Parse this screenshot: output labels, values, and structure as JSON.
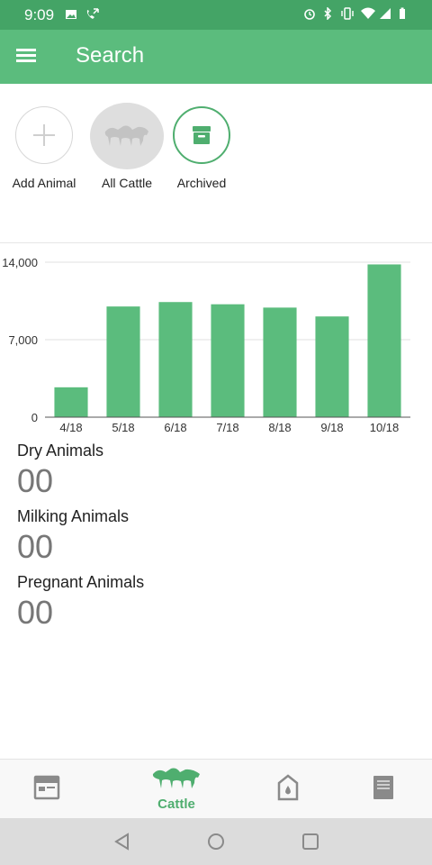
{
  "status_bar": {
    "time": "9:09",
    "left_icons": [
      "image-icon",
      "call-forward-icon"
    ],
    "right_icons": [
      "alarm-icon",
      "bluetooth-icon",
      "vibrate-icon",
      "wifi-icon",
      "signal-icon",
      "battery-icon"
    ]
  },
  "app_bar": {
    "title": "Search",
    "menu_icon": "menu-icon",
    "color": "#5bbc7d"
  },
  "quick_actions": [
    {
      "label": "Add Animal",
      "icon": "plus-icon"
    },
    {
      "label": "All Cattle",
      "icon": "cattle-icon"
    },
    {
      "label": "Archived",
      "icon": "archive-box-icon"
    }
  ],
  "chart_data": {
    "type": "bar",
    "categories": [
      "4/18",
      "5/18",
      "6/18",
      "7/18",
      "8/18",
      "9/18",
      "10/18"
    ],
    "values": [
      2700,
      10000,
      10400,
      10200,
      9900,
      9100,
      13800
    ],
    "ylim": [
      0,
      14000
    ],
    "yticks": [
      "0",
      "7,000",
      "14,000"
    ],
    "ytick_values": [
      0,
      7000,
      14000
    ],
    "grid": true,
    "bar_color": "#5bbc7d"
  },
  "stats": [
    {
      "label": "Dry Animals",
      "value": "00"
    },
    {
      "label": "Milking Animals",
      "value": "00"
    },
    {
      "label": "Pregnant Animals",
      "value": "00"
    }
  ],
  "bottom_nav": [
    {
      "label": "",
      "icon": "calendar-icon"
    },
    {
      "label": "Cattle",
      "icon": "cattle-icon",
      "active": true
    },
    {
      "label": "",
      "icon": "milk-tag-icon"
    },
    {
      "label": "",
      "icon": "notes-icon"
    }
  ],
  "system_nav": [
    "back-icon",
    "home-icon",
    "recents-icon"
  ],
  "accent_color": "#4fae6f"
}
